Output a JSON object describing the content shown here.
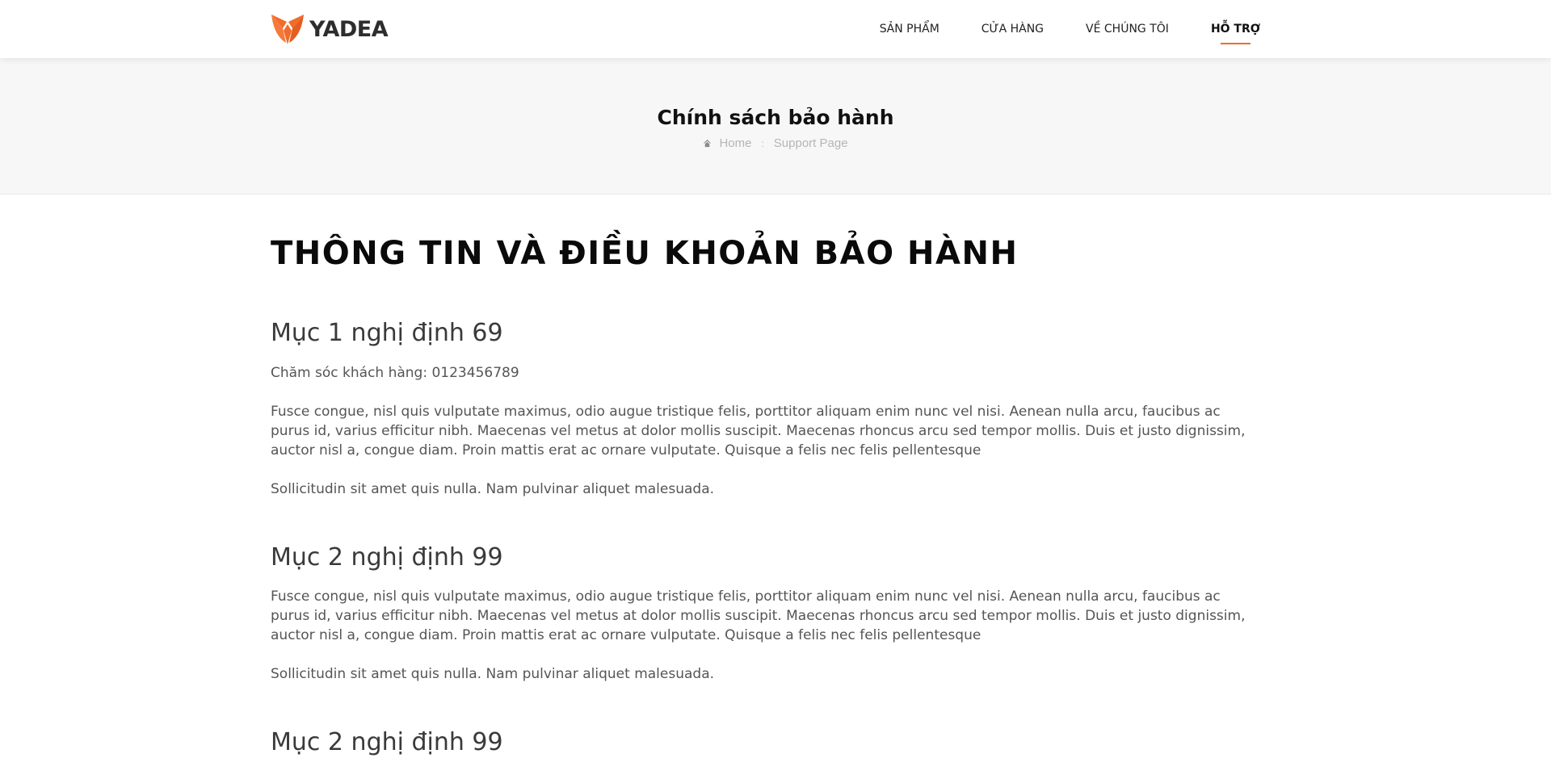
{
  "header": {
    "logo_text": "YADEA",
    "nav": [
      {
        "label": "SẢN PHẨM"
      },
      {
        "label": "CỬA HÀNG"
      },
      {
        "label": "VỀ CHÚNG TÔI"
      },
      {
        "label": "HỖ TRỢ"
      }
    ],
    "active_nav": "HỖ TRỢ",
    "accent_color": "#f26b2a"
  },
  "banner": {
    "title": "Chính sách bảo hành",
    "breadcrumb": {
      "home": "Home",
      "separator": ":",
      "current": "Support Page"
    }
  },
  "content": {
    "heading": "THÔNG TIN VÀ ĐIỀU KHOẢN BẢO HÀNH",
    "sections": [
      {
        "title": "Mục 1 nghị định 69",
        "paragraphs": [
          "Chăm sóc khách hàng: 0123456789",
          "Fusce congue, nisl quis vulputate maximus, odio augue tristique felis, porttitor aliquam enim nunc vel nisi. Aenean nulla arcu, faucibus ac purus id, varius efficitur nibh. Maecenas vel metus at dolor mollis suscipit. Maecenas rhoncus arcu sed tempor mollis. Duis et justo dignissim, auctor nisl a, congue diam. Proin mattis erat ac ornare vulputate. Quisque a felis nec felis pellentesque",
          "Sollicitudin sit amet quis nulla. Nam pulvinar aliquet malesuada."
        ]
      },
      {
        "title": "Mục 2 nghị định 99",
        "paragraphs": [
          "Fusce congue, nisl quis vulputate maximus, odio augue tristique felis, porttitor aliquam enim nunc vel nisi. Aenean nulla arcu, faucibus ac purus id, varius efficitur nibh. Maecenas vel metus at dolor mollis suscipit. Maecenas rhoncus arcu sed tempor mollis. Duis et justo dignissim, auctor nisl a, congue diam. Proin mattis erat ac ornare vulputate. Quisque a felis nec felis pellentesque",
          "Sollicitudin sit amet quis nulla. Nam pulvinar aliquet malesuada."
        ]
      },
      {
        "title": "Mục 2 nghị định 99",
        "paragraphs": []
      }
    ]
  }
}
